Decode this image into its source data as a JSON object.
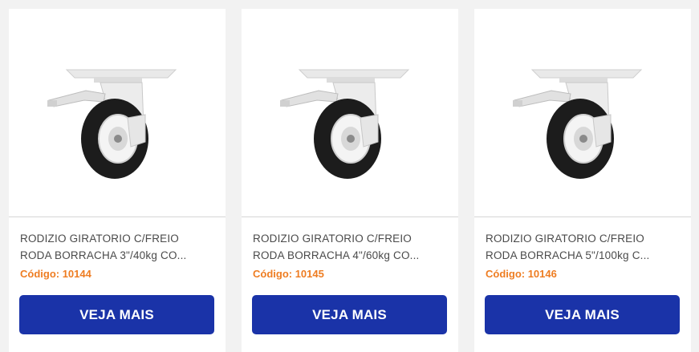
{
  "colors": {
    "button_bg": "#1a33a8",
    "code_text": "#ee7d22",
    "title_text": "#4a4a4a"
  },
  "products": [
    {
      "title_line1": "RODIZIO GIRATORIO C/FREIO",
      "title_line2": "RODA BORRACHA 3\"/40kg CO...",
      "code": "Código: 10144",
      "button_label": "VEJA MAIS",
      "image_icon": "swivel-caster-with-brake-icon"
    },
    {
      "title_line1": "RODIZIO GIRATORIO C/FREIO",
      "title_line2": "RODA BORRACHA 4\"/60kg CO...",
      "code": "Código: 10145",
      "button_label": "VEJA MAIS",
      "image_icon": "swivel-caster-with-brake-icon"
    },
    {
      "title_line1": "RODIZIO GIRATORIO C/FREIO",
      "title_line2": "RODA BORRACHA 5\"/100kg C...",
      "code": "Código: 10146",
      "button_label": "VEJA MAIS",
      "image_icon": "swivel-caster-with-brake-icon"
    }
  ]
}
